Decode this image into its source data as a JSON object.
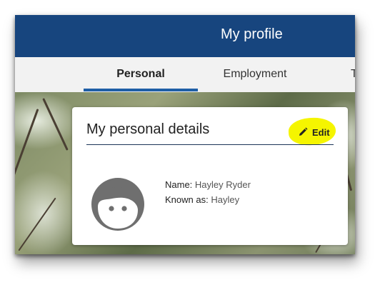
{
  "header": {
    "title": "My profile"
  },
  "tabs": [
    {
      "label": "Personal",
      "active": true
    },
    {
      "label": "Employment",
      "active": false
    },
    {
      "label": "T",
      "active": false
    }
  ],
  "card": {
    "title": "My personal details",
    "edit_label": "Edit",
    "edit_icon": "pencil-icon",
    "avatar_icon": "face-avatar-icon",
    "fields": [
      {
        "key": "Name:",
        "value": "Hayley Ryder"
      },
      {
        "key": "Known as:",
        "value": "Hayley"
      }
    ]
  },
  "colors": {
    "header_bg": "#17457e",
    "tab_underline": "#1f5fa6",
    "highlight": "#f5f500"
  }
}
